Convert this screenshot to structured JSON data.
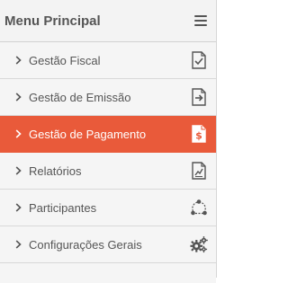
{
  "header": {
    "title": "Menu Principal"
  },
  "menu": {
    "items": [
      {
        "label": "Gestão Fiscal",
        "icon": "document-check-icon",
        "active": false
      },
      {
        "label": "Gestão de Emissão",
        "icon": "document-export-icon",
        "active": false
      },
      {
        "label": "Gestão de Pagamento",
        "icon": "document-dollar-icon",
        "active": true
      },
      {
        "label": "Relatórios",
        "icon": "document-chart-icon",
        "active": false
      },
      {
        "label": "Participantes",
        "icon": "network-icon",
        "active": false
      },
      {
        "label": "Configurações Gerais",
        "icon": "gears-icon",
        "active": false
      }
    ]
  },
  "colors": {
    "accent": "#e95a3a",
    "text": "#555555",
    "background": "#f5f5f5"
  }
}
